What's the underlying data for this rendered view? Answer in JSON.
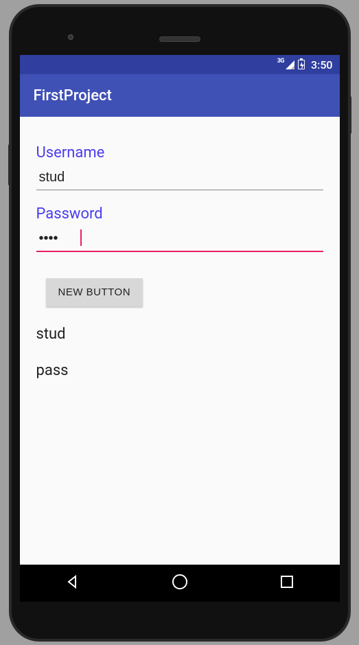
{
  "status": {
    "network": "3G",
    "time": "3:50"
  },
  "app": {
    "title": "FirstProject"
  },
  "form": {
    "username_label": "Username",
    "username_value": "stud",
    "password_label": "Password",
    "password_value": "••••",
    "button_label": "NEW BUTTON"
  },
  "output": {
    "line1": "stud",
    "line2": "pass"
  },
  "colors": {
    "primary": "#3F51B5",
    "primaryDark": "#303F9F",
    "accent": "#E91E63",
    "labelAccent": "#4b3cf0"
  }
}
